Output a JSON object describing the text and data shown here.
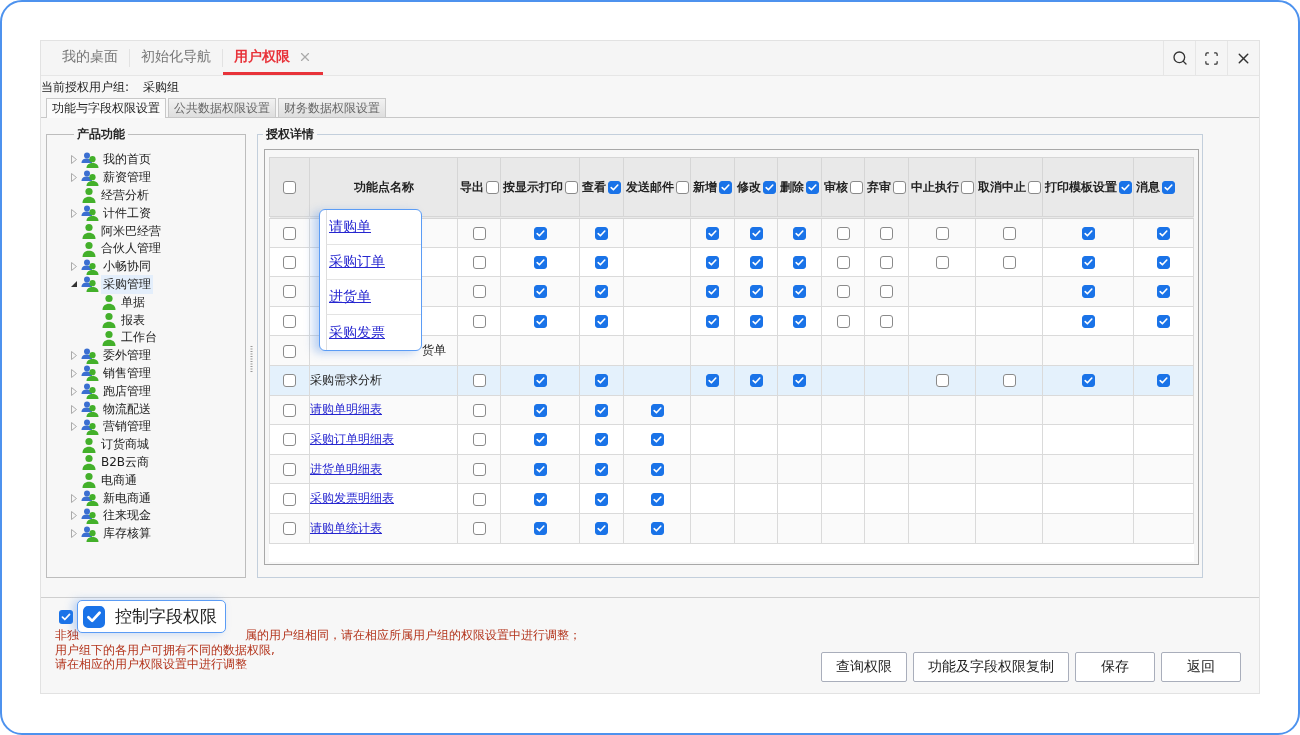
{
  "frame_tabs": [
    {
      "label": "我的桌面",
      "selected": false,
      "closable": false
    },
    {
      "label": "初始化导航",
      "selected": false,
      "closable": false
    },
    {
      "label": "用户权限",
      "selected": true,
      "closable": true
    }
  ],
  "user_group": {
    "label": "当前授权用户组:",
    "value": "采购组"
  },
  "sub_tabs": [
    {
      "label": "功能与字段权限设置",
      "selected": true
    },
    {
      "label": "公共数据权限设置",
      "selected": false
    },
    {
      "label": "财务数据权限设置",
      "selected": false
    }
  ],
  "product_panel": {
    "title": "产品功能",
    "tree": [
      {
        "label": "我的首页",
        "kind": "group",
        "expanded": false,
        "selected": false
      },
      {
        "label": "薪资管理",
        "kind": "group",
        "expanded": false,
        "selected": false
      },
      {
        "label": "经营分析",
        "kind": "leaf",
        "selected": false
      },
      {
        "label": "计件工资",
        "kind": "group",
        "expanded": false,
        "selected": false
      },
      {
        "label": "阿米巴经营",
        "kind": "leaf",
        "selected": false
      },
      {
        "label": "合伙人管理",
        "kind": "leaf",
        "selected": false
      },
      {
        "label": "小畅协同",
        "kind": "group",
        "expanded": false,
        "selected": false
      },
      {
        "label": "采购管理",
        "kind": "group",
        "expanded": true,
        "selected": true,
        "children": [
          {
            "label": "单据",
            "kind": "leaf",
            "selected": false
          },
          {
            "label": "报表",
            "kind": "leaf",
            "selected": false
          },
          {
            "label": "工作台",
            "kind": "leaf",
            "selected": false
          }
        ]
      },
      {
        "label": "委外管理",
        "kind": "group",
        "expanded": false,
        "selected": false
      },
      {
        "label": "销售管理",
        "kind": "group",
        "expanded": false,
        "selected": false
      },
      {
        "label": "跑店管理",
        "kind": "group",
        "expanded": false,
        "selected": false
      },
      {
        "label": "物流配送",
        "kind": "group",
        "expanded": false,
        "selected": false
      },
      {
        "label": "营销管理",
        "kind": "group",
        "expanded": false,
        "selected": false
      },
      {
        "label": "订货商城",
        "kind": "leaf",
        "selected": false
      },
      {
        "label": "B2B云商",
        "kind": "leaf",
        "selected": false
      },
      {
        "label": "电商通",
        "kind": "leaf",
        "selected": false
      },
      {
        "label": "新电商通",
        "kind": "group",
        "expanded": false,
        "selected": false
      },
      {
        "label": "往来现金",
        "kind": "group",
        "expanded": false,
        "selected": false
      },
      {
        "label": "库存核算",
        "kind": "group",
        "expanded": false,
        "selected": false
      }
    ]
  },
  "detail_panel": {
    "title": "授权详情",
    "select_all": {
      "checked": false
    },
    "name_column": "功能点名称",
    "perm_columns": [
      {
        "label": "导出",
        "checked": false
      },
      {
        "label": "按显示打印",
        "checked": false
      },
      {
        "label": "查看",
        "checked": true
      },
      {
        "label": "发送邮件",
        "checked": false
      },
      {
        "label": "新增",
        "checked": true
      },
      {
        "label": "修改",
        "checked": true
      },
      {
        "label": "删除",
        "checked": true
      },
      {
        "label": "审核",
        "checked": false
      },
      {
        "label": "弃审",
        "checked": false
      },
      {
        "label": "中止执行",
        "checked": false
      },
      {
        "label": "取消中止",
        "checked": false
      },
      {
        "label": "打印模板设置",
        "checked": true
      },
      {
        "label": "消息",
        "checked": true
      }
    ],
    "rows": [
      {
        "kind": "covered",
        "selected": false,
        "checked": false,
        "perms": [
          {
            "kind": "check",
            "checked": false
          },
          {
            "kind": "check",
            "checked": true
          },
          {
            "kind": "check",
            "checked": true
          },
          {
            "kind": "blank"
          },
          {
            "kind": "check",
            "checked": true
          },
          {
            "kind": "check",
            "checked": true
          },
          {
            "kind": "check",
            "checked": true
          },
          {
            "kind": "check",
            "checked": false
          },
          {
            "kind": "check",
            "checked": false
          },
          {
            "kind": "check",
            "checked": false
          },
          {
            "kind": "check",
            "checked": false
          },
          {
            "kind": "check",
            "checked": true
          },
          {
            "kind": "check",
            "checked": true
          }
        ]
      },
      {
        "kind": "covered",
        "selected": false,
        "checked": false,
        "perms": [
          {
            "kind": "check",
            "checked": false
          },
          {
            "kind": "check",
            "checked": true
          },
          {
            "kind": "check",
            "checked": true
          },
          {
            "kind": "blank"
          },
          {
            "kind": "check",
            "checked": true
          },
          {
            "kind": "check",
            "checked": true
          },
          {
            "kind": "check",
            "checked": true
          },
          {
            "kind": "check",
            "checked": false
          },
          {
            "kind": "check",
            "checked": false
          },
          {
            "kind": "check",
            "checked": false
          },
          {
            "kind": "check",
            "checked": false
          },
          {
            "kind": "check",
            "checked": true
          },
          {
            "kind": "check",
            "checked": true
          }
        ]
      },
      {
        "kind": "covered",
        "selected": false,
        "checked": false,
        "perms": [
          {
            "kind": "check",
            "checked": false
          },
          {
            "kind": "check",
            "checked": true
          },
          {
            "kind": "check",
            "checked": true
          },
          {
            "kind": "blank"
          },
          {
            "kind": "check",
            "checked": true
          },
          {
            "kind": "check",
            "checked": true
          },
          {
            "kind": "check",
            "checked": true
          },
          {
            "kind": "check",
            "checked": false
          },
          {
            "kind": "check",
            "checked": false
          },
          {
            "kind": "blank"
          },
          {
            "kind": "blank"
          },
          {
            "kind": "check",
            "checked": true
          },
          {
            "kind": "check",
            "checked": true
          }
        ]
      },
      {
        "kind": "covered",
        "selected": false,
        "checked": false,
        "perms": [
          {
            "kind": "check",
            "checked": false
          },
          {
            "kind": "check",
            "checked": true
          },
          {
            "kind": "check",
            "checked": true
          },
          {
            "kind": "blank"
          },
          {
            "kind": "check",
            "checked": true
          },
          {
            "kind": "check",
            "checked": true
          },
          {
            "kind": "check",
            "checked": true
          },
          {
            "kind": "check",
            "checked": false
          },
          {
            "kind": "check",
            "checked": false
          },
          {
            "kind": "blank"
          },
          {
            "kind": "blank"
          },
          {
            "kind": "check",
            "checked": true
          },
          {
            "kind": "check",
            "checked": true
          }
        ]
      },
      {
        "kind": "covered",
        "name": "货单",
        "selected": false,
        "checked": false,
        "perms": [
          {
            "kind": "blank"
          },
          {
            "kind": "blank"
          },
          {
            "kind": "blank"
          },
          {
            "kind": "blank"
          },
          {
            "kind": "blank"
          },
          {
            "kind": "blank"
          },
          {
            "kind": "blank"
          },
          {
            "kind": "blank"
          },
          {
            "kind": "blank"
          },
          {
            "kind": "blank"
          },
          {
            "kind": "blank"
          },
          {
            "kind": "blank"
          },
          {
            "kind": "blank"
          }
        ]
      },
      {
        "kind": "text",
        "name": "采购需求分析",
        "selected": true,
        "checked": false,
        "perms": [
          {
            "kind": "check",
            "checked": false
          },
          {
            "kind": "check",
            "checked": true
          },
          {
            "kind": "check",
            "checked": true
          },
          {
            "kind": "blank"
          },
          {
            "kind": "check",
            "checked": true
          },
          {
            "kind": "check",
            "checked": true
          },
          {
            "kind": "check",
            "checked": true
          },
          {
            "kind": "blank"
          },
          {
            "kind": "blank"
          },
          {
            "kind": "check",
            "checked": false
          },
          {
            "kind": "check",
            "checked": false
          },
          {
            "kind": "check",
            "checked": true
          },
          {
            "kind": "check",
            "checked": true
          }
        ]
      },
      {
        "kind": "link",
        "name": "请购单明细表",
        "selected": false,
        "checked": false,
        "perms": [
          {
            "kind": "check",
            "checked": false
          },
          {
            "kind": "check",
            "checked": true
          },
          {
            "kind": "check",
            "checked": true
          },
          {
            "kind": "check",
            "checked": true
          }
        ]
      },
      {
        "kind": "link",
        "name": "采购订单明细表",
        "selected": false,
        "checked": false,
        "perms": [
          {
            "kind": "check",
            "checked": false
          },
          {
            "kind": "check",
            "checked": true
          },
          {
            "kind": "check",
            "checked": true
          },
          {
            "kind": "check",
            "checked": true
          }
        ]
      },
      {
        "kind": "link",
        "name": "进货单明细表",
        "selected": false,
        "checked": false,
        "perms": [
          {
            "kind": "check",
            "checked": false
          },
          {
            "kind": "check",
            "checked": true
          },
          {
            "kind": "check",
            "checked": true
          },
          {
            "kind": "check",
            "checked": true
          }
        ]
      },
      {
        "kind": "link",
        "name": "采购发票明细表",
        "selected": false,
        "checked": false,
        "perms": [
          {
            "kind": "check",
            "checked": false
          },
          {
            "kind": "check",
            "checked": true
          },
          {
            "kind": "check",
            "checked": true
          },
          {
            "kind": "check",
            "checked": true
          }
        ]
      },
      {
        "kind": "link",
        "name": "请购单统计表",
        "selected": false,
        "checked": false,
        "perms": [
          {
            "kind": "check",
            "checked": false
          },
          {
            "kind": "check",
            "checked": true
          },
          {
            "kind": "check",
            "checked": true
          },
          {
            "kind": "check",
            "checked": true
          }
        ]
      }
    ],
    "name_popup": [
      "请购单",
      "采购订单",
      "进货单",
      "采购发票"
    ]
  },
  "field_control": {
    "label": "控制字段权限",
    "checked": true
  },
  "note_lines": [
    [
      "非独",
      "属的用户组相同，请在相应所属用户组的权限设置中进行调整；"
    ],
    [
      "用户组下的各用户可拥有不同的数据权限,"
    ],
    [
      "请在相应的用户权限设置中进行调整"
    ]
  ],
  "buttons": [
    "查询权限",
    "功能及字段权限复制",
    "保存",
    "返回"
  ]
}
